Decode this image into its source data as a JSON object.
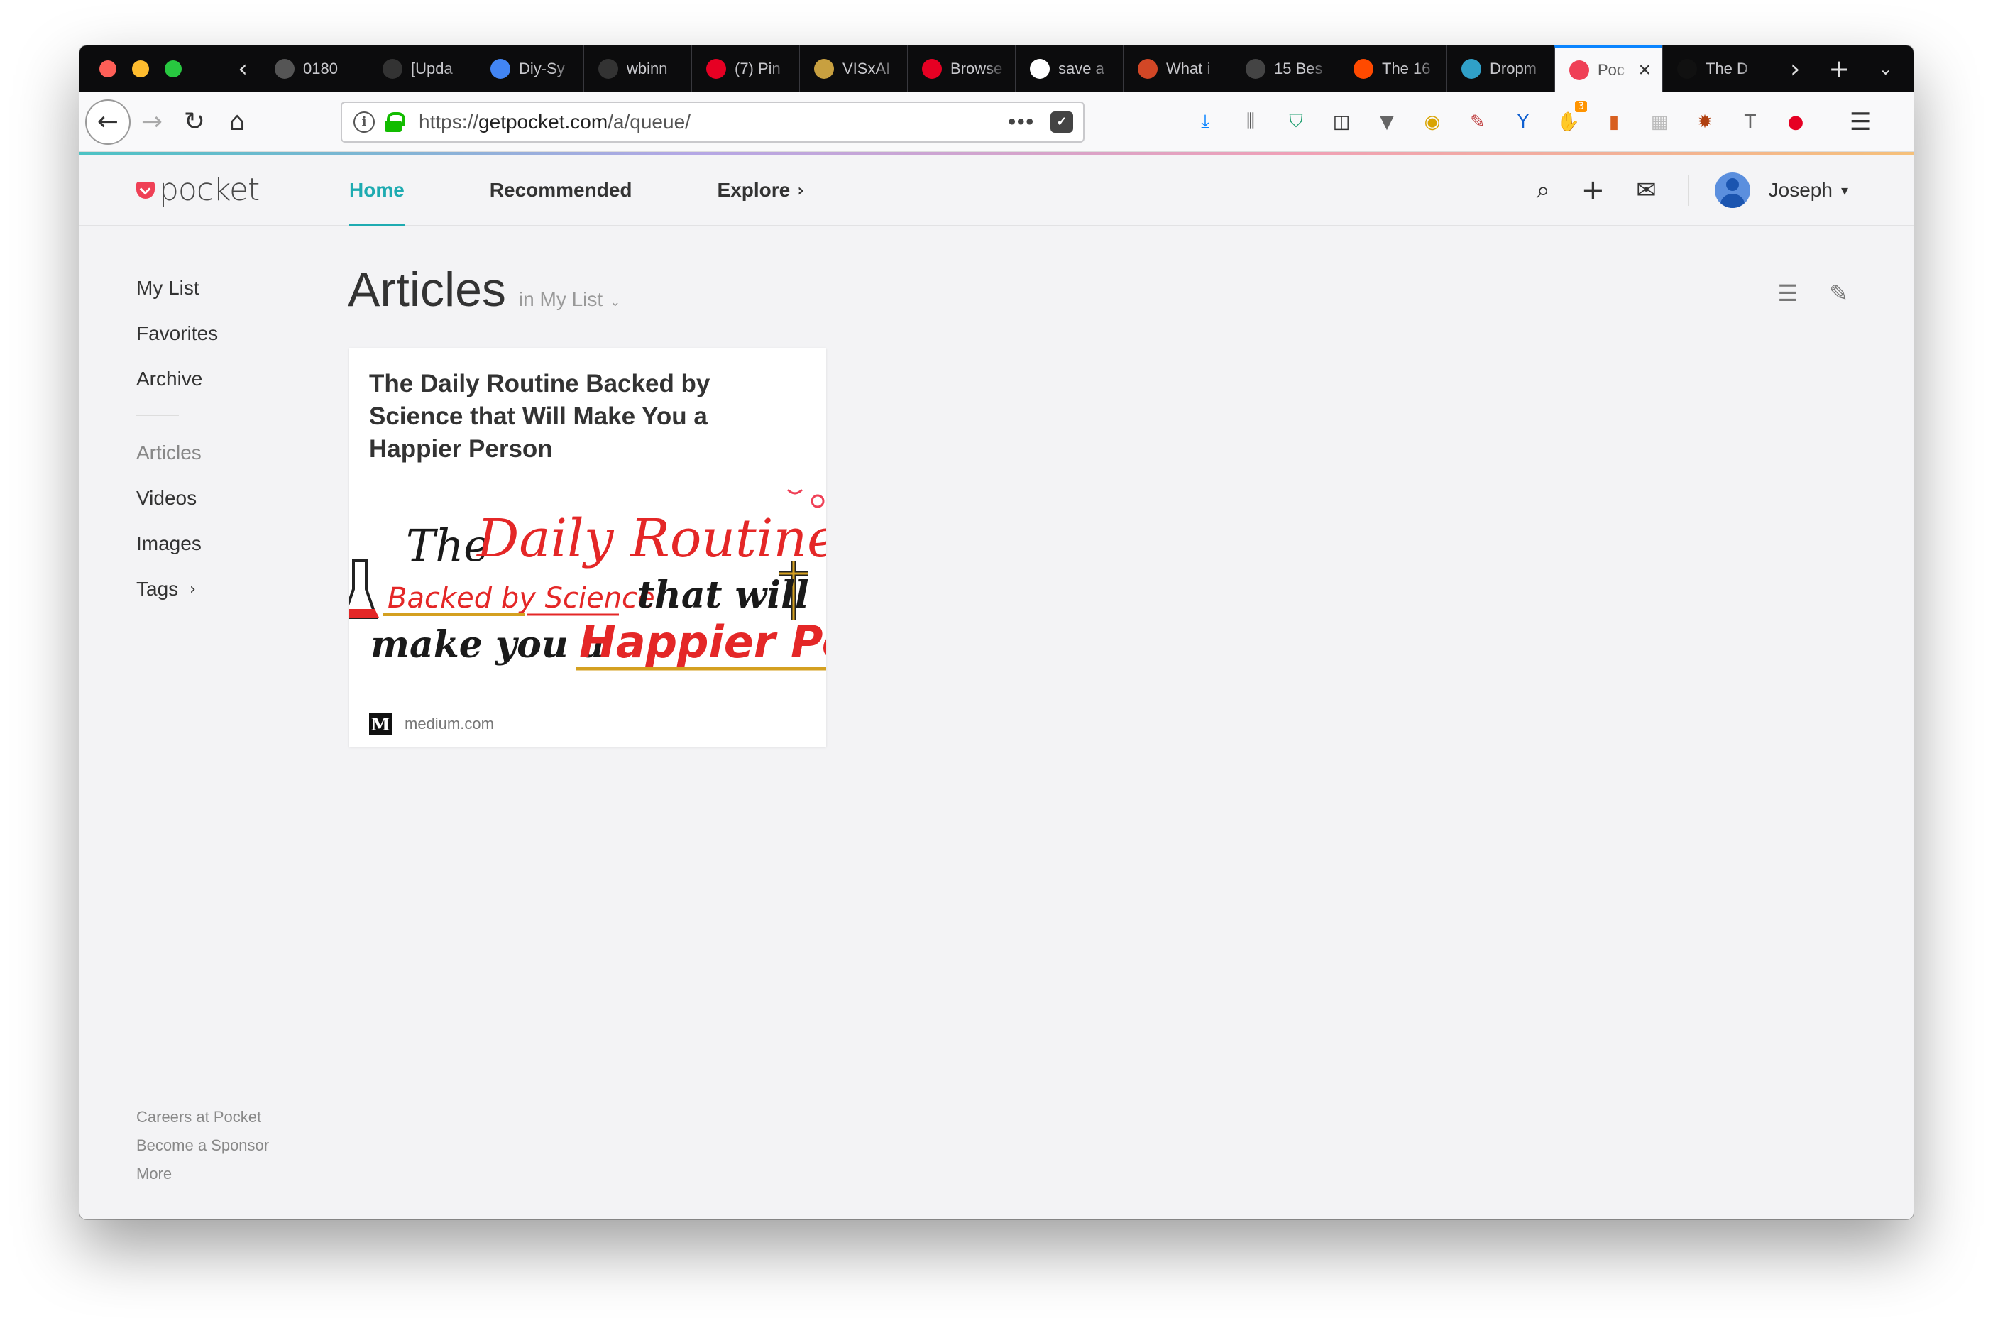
{
  "browser": {
    "tabs": [
      {
        "title": "0180",
        "favicon": "generic-icon",
        "color": "#555555"
      },
      {
        "title": "[Upda",
        "favicon": "github-icon",
        "color": "#333333"
      },
      {
        "title": "Diy-Sy",
        "favicon": "google-docs-icon",
        "color": "#4285f4"
      },
      {
        "title": "wbinn",
        "favicon": "github-icon",
        "color": "#333333"
      },
      {
        "title": "(7) Pin",
        "favicon": "pinterest-icon",
        "color": "#e60023"
      },
      {
        "title": "VISxAI",
        "favicon": "dna-icon",
        "color": "#c8a040"
      },
      {
        "title": "Browse",
        "favicon": "pinterest-icon",
        "color": "#e60023"
      },
      {
        "title": "save a",
        "favicon": "google-icon",
        "color": "#ffffff"
      },
      {
        "title": "What i",
        "favicon": "powerpoint-icon",
        "color": "#d24726"
      },
      {
        "title": "15 Bes",
        "favicon": "one-icon",
        "color": "#444444"
      },
      {
        "title": "The 16",
        "favicon": "zapier-icon",
        "color": "#ff4a00"
      },
      {
        "title": "Dropm",
        "favicon": "drop-icon",
        "color": "#30a0c8"
      },
      {
        "title": "Poc",
        "favicon": "pocket-icon",
        "color": "#ef4056",
        "active": true
      },
      {
        "title": "The D",
        "favicon": "medium-icon",
        "color": "#111111"
      }
    ],
    "url_prefix": "https://",
    "url_host": "getpocket.com",
    "url_path": "/a/queue/",
    "extension_badge": "3"
  },
  "pocket": {
    "logo_text": "pocket",
    "nav": {
      "home": "Home",
      "recommended": "Recommended",
      "explore": "Explore"
    },
    "user_name": "Joseph"
  },
  "sidebar": {
    "my_list": "My List",
    "favorites": "Favorites",
    "archive": "Archive",
    "articles": "Articles",
    "videos": "Videos",
    "images": "Images",
    "tags": "Tags"
  },
  "footer": {
    "careers": "Careers at Pocket",
    "sponsor": "Become a Sponsor",
    "more": "More"
  },
  "main": {
    "title": "Articles",
    "subtitle": "in My List"
  },
  "card": {
    "title": "The Daily Routine Backed by Science that Will Make You a Happier Person",
    "domain": "medium.com",
    "image_text": {
      "the": "The",
      "daily_routine": "Daily Routine",
      "backed_by_science": "Backed by Science",
      "that_will": "that will",
      "make_you_a": "make you a",
      "happier_person": "Happier Person"
    }
  },
  "colors": {
    "pocket_red": "#ef4056",
    "pocket_teal": "#1eabb1"
  }
}
